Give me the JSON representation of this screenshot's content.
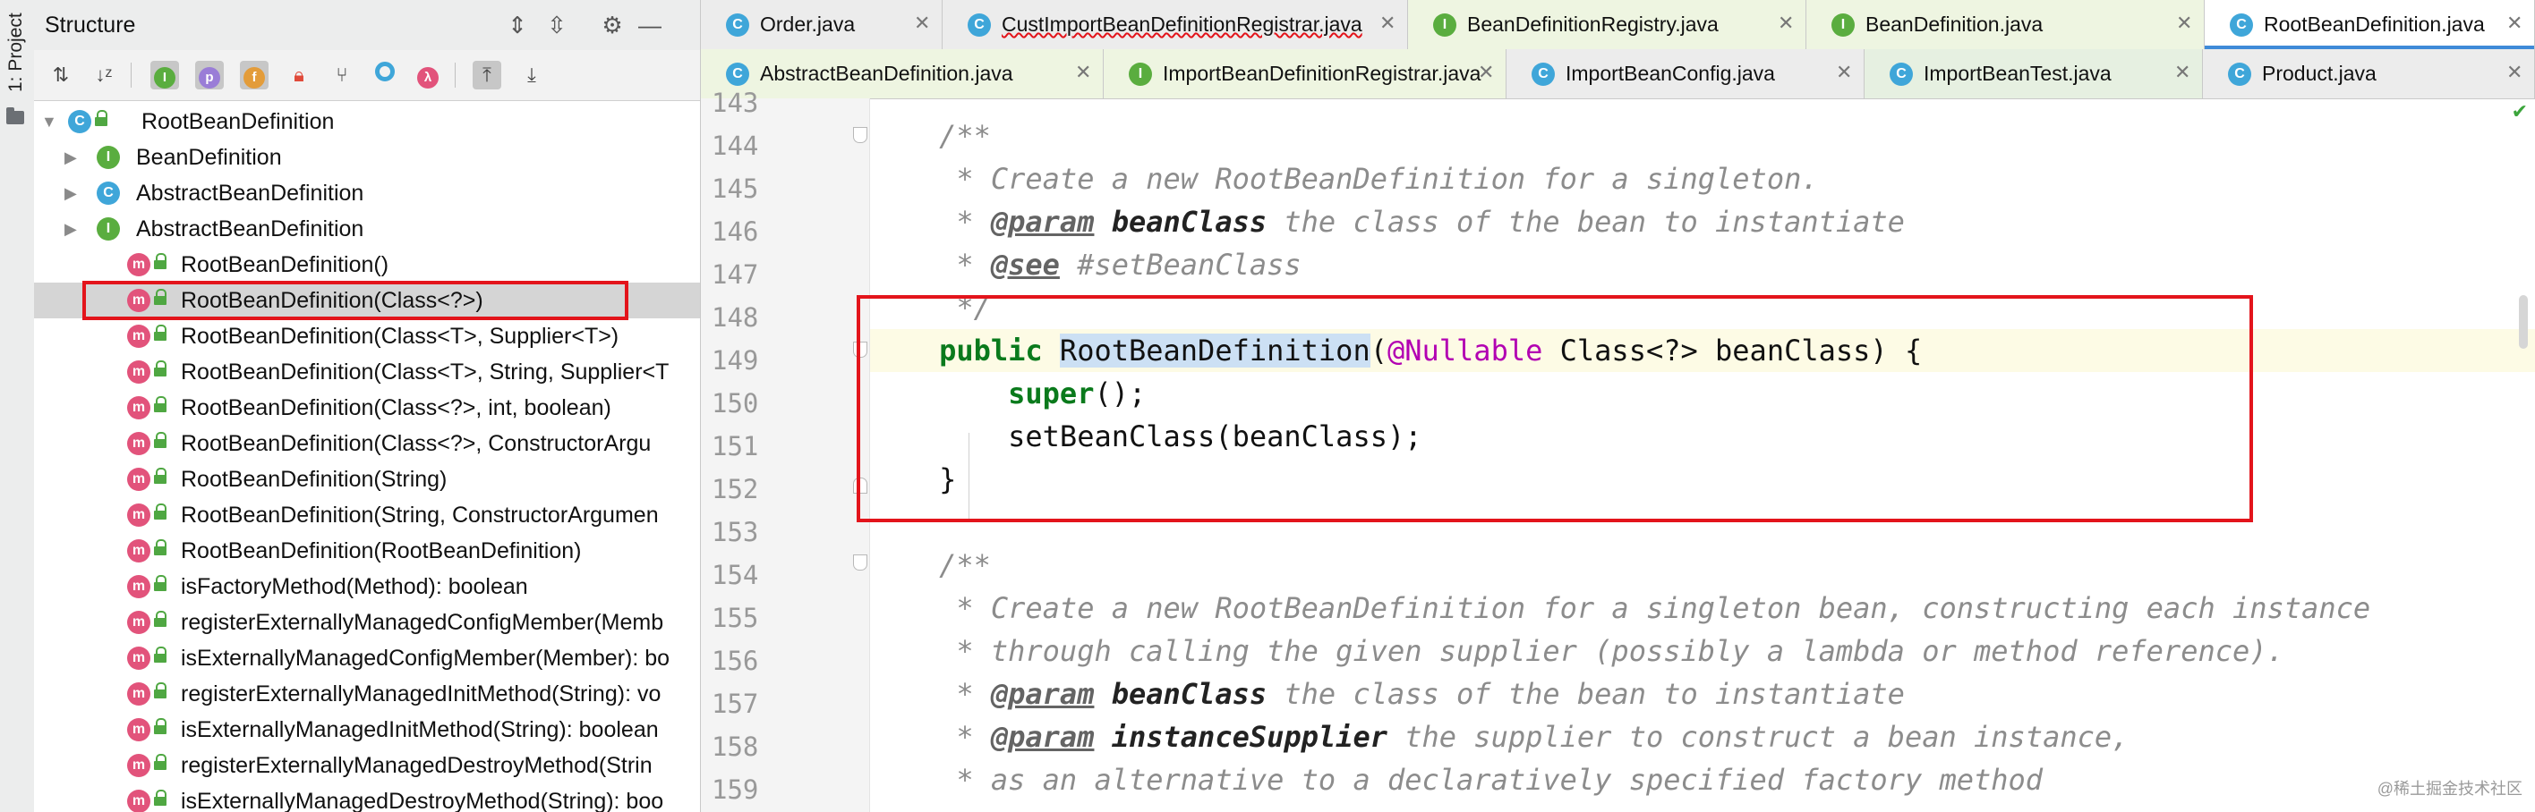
{
  "left_strip": {
    "label": "1: Project"
  },
  "structure": {
    "title": "Structure",
    "tree": [
      {
        "label": "RootBeanDefinition",
        "icon": "C",
        "kind": "c",
        "arrow": "▼",
        "level": 0
      },
      {
        "label": "BeanDefinition",
        "icon": "I",
        "kind": "i",
        "arrow": "▶",
        "level": 1
      },
      {
        "label": "AbstractBeanDefinition",
        "icon": "C",
        "kind": "o",
        "arrow": "▶",
        "level": 1
      },
      {
        "label": "AbstractBeanDefinition",
        "icon": "I",
        "kind": "i",
        "arrow": "▶",
        "level": 1
      },
      {
        "label": "RootBeanDefinition()",
        "icon": "m",
        "kind": "m",
        "level": 2
      },
      {
        "label": "RootBeanDefinition(Class<?>)",
        "icon": "m",
        "kind": "m",
        "level": 2,
        "selected": true
      },
      {
        "label": "RootBeanDefinition(Class<T>, Supplier<T>)",
        "icon": "m",
        "kind": "m",
        "level": 2
      },
      {
        "label": "RootBeanDefinition(Class<T>, String, Supplier<T",
        "icon": "m",
        "kind": "m",
        "level": 2
      },
      {
        "label": "RootBeanDefinition(Class<?>, int, boolean)",
        "icon": "m",
        "kind": "m",
        "level": 2
      },
      {
        "label": "RootBeanDefinition(Class<?>, ConstructorArgu",
        "icon": "m",
        "kind": "m",
        "level": 2
      },
      {
        "label": "RootBeanDefinition(String)",
        "icon": "m",
        "kind": "m",
        "level": 2
      },
      {
        "label": "RootBeanDefinition(String, ConstructorArgumen",
        "icon": "m",
        "kind": "m",
        "level": 2
      },
      {
        "label": "RootBeanDefinition(RootBeanDefinition)",
        "icon": "m",
        "kind": "m",
        "level": 2
      },
      {
        "label": "isFactoryMethod(Method): boolean",
        "icon": "m",
        "kind": "m",
        "level": 2
      },
      {
        "label": "registerExternallyManagedConfigMember(Memb",
        "icon": "m",
        "kind": "m",
        "level": 2
      },
      {
        "label": "isExternallyManagedConfigMember(Member): bo",
        "icon": "m",
        "kind": "m",
        "level": 2
      },
      {
        "label": "registerExternallyManagedInitMethod(String): vo",
        "icon": "m",
        "kind": "m",
        "level": 2
      },
      {
        "label": "isExternallyManagedInitMethod(String): boolean",
        "icon": "m",
        "kind": "m",
        "level": 2
      },
      {
        "label": "registerExternallyManagedDestroyMethod(Strin",
        "icon": "m",
        "kind": "m",
        "level": 2
      },
      {
        "label": "isExternallyManagedDestroyMethod(String): boo",
        "icon": "m",
        "kind": "m",
        "level": 2
      }
    ]
  },
  "tabs": {
    "row1": [
      {
        "label": "Order.java",
        "icon": "C",
        "kind": "c",
        "style": "gray"
      },
      {
        "label": "CustImportBeanDefinitionRegistrar.java",
        "icon": "C",
        "kind": "c",
        "style": "gray",
        "error": true
      },
      {
        "label": "BeanDefinitionRegistry.java",
        "icon": "I",
        "kind": "i",
        "style": "green"
      },
      {
        "label": "BeanDefinition.java",
        "icon": "I",
        "kind": "i",
        "style": "green"
      },
      {
        "label": "RootBeanDefinition.java",
        "icon": "C",
        "kind": "c",
        "style": "active"
      }
    ],
    "row2": [
      {
        "label": "AbstractBeanDefinition.java",
        "icon": "C",
        "kind": "o",
        "style": "green"
      },
      {
        "label": "ImportBeanDefinitionRegistrar.java",
        "icon": "I",
        "kind": "i",
        "style": "green"
      },
      {
        "label": "ImportBeanConfig.java",
        "icon": "C",
        "kind": "c",
        "style": "gray"
      },
      {
        "label": "ImportBeanTest.java",
        "icon": "C",
        "kind": "c",
        "style": "lgreen"
      },
      {
        "label": "Product.java",
        "icon": "C",
        "kind": "c",
        "style": "gray"
      }
    ]
  },
  "editor": {
    "line_numbers": [
      "143",
      "144",
      "145",
      "146",
      "147",
      "148",
      "149",
      "150",
      "151",
      "152",
      "153",
      "154",
      "155",
      "156",
      "157",
      "158",
      "159"
    ],
    "code": {
      "l144": "    /**",
      "l145_a": "     * ",
      "l145_b": "Create a new RootBeanDefinition for a singleton.",
      "l146_star": "     * ",
      "l146_tag": "@param",
      "l146_name": "beanClass",
      "l146_rest": " the class of the bean to instantiate",
      "l147_star": "     * ",
      "l147_tag": "@see",
      "l147_rest": " #setBeanClass",
      "l148": "     */",
      "l149_kw": "public",
      "l149_name": "RootBeanDefinition",
      "l149_p1": "(",
      "l149_ann": "@Nullable",
      "l149_rest": " Class<?> beanClass) {",
      "l150_kw": "super",
      "l150_rest": "();",
      "l151": "setBeanClass(beanClass);",
      "l152": "    }",
      "l154": "    /**",
      "l155": "     * Create a new RootBeanDefinition for a singleton bean, constructing each instance",
      "l156": "     * through calling the given supplier (possibly a lambda or method reference).",
      "l157_star": "     * ",
      "l157_tag": "@param",
      "l157_name": "beanClass",
      "l157_rest": " the class of the bean to instantiate",
      "l158_star": "     * ",
      "l158_tag": "@param",
      "l158_name": "instanceSupplier",
      "l158_rest": " the supplier to construct a bean instance,",
      "l159": "     * as an alternative to a declaratively specified factory method"
    },
    "watermark": "@稀土掘金技术社区"
  }
}
